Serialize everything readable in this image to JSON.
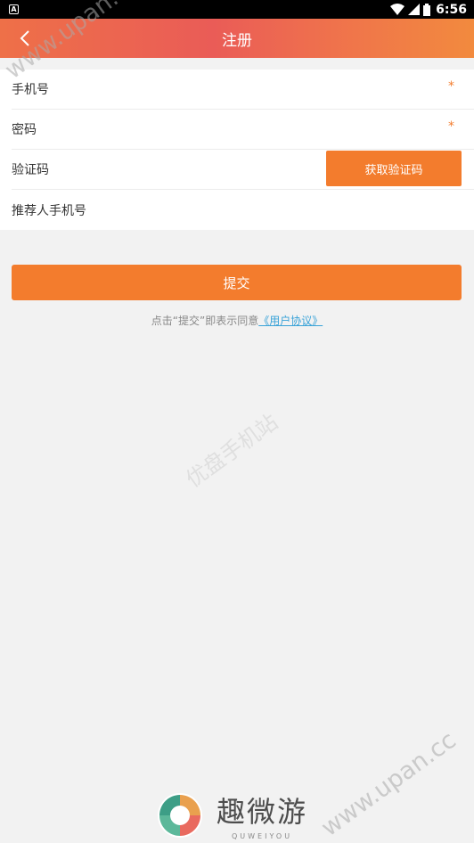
{
  "status": {
    "time": "6:56",
    "notif_glyph": "A"
  },
  "appbar": {
    "title": "注册"
  },
  "form": {
    "phone_label": "手机号",
    "password_label": "密码",
    "code_label": "验证码",
    "code_button": "获取验证码",
    "referrer_label": "推荐人手机号",
    "required_mark": "*"
  },
  "submit_label": "提交",
  "agreement": {
    "prefix": "点击“提交”即表示同意",
    "link": "《用户协议》"
  },
  "watermark": {
    "domain": "www.upan.cc",
    "center_text": "优盘手机站"
  },
  "footer_logo": {
    "name": "趣微游",
    "sub": "QUWEIYOU"
  },
  "colors": {
    "accent": "#f37c2d",
    "link": "#3aa3d8"
  }
}
